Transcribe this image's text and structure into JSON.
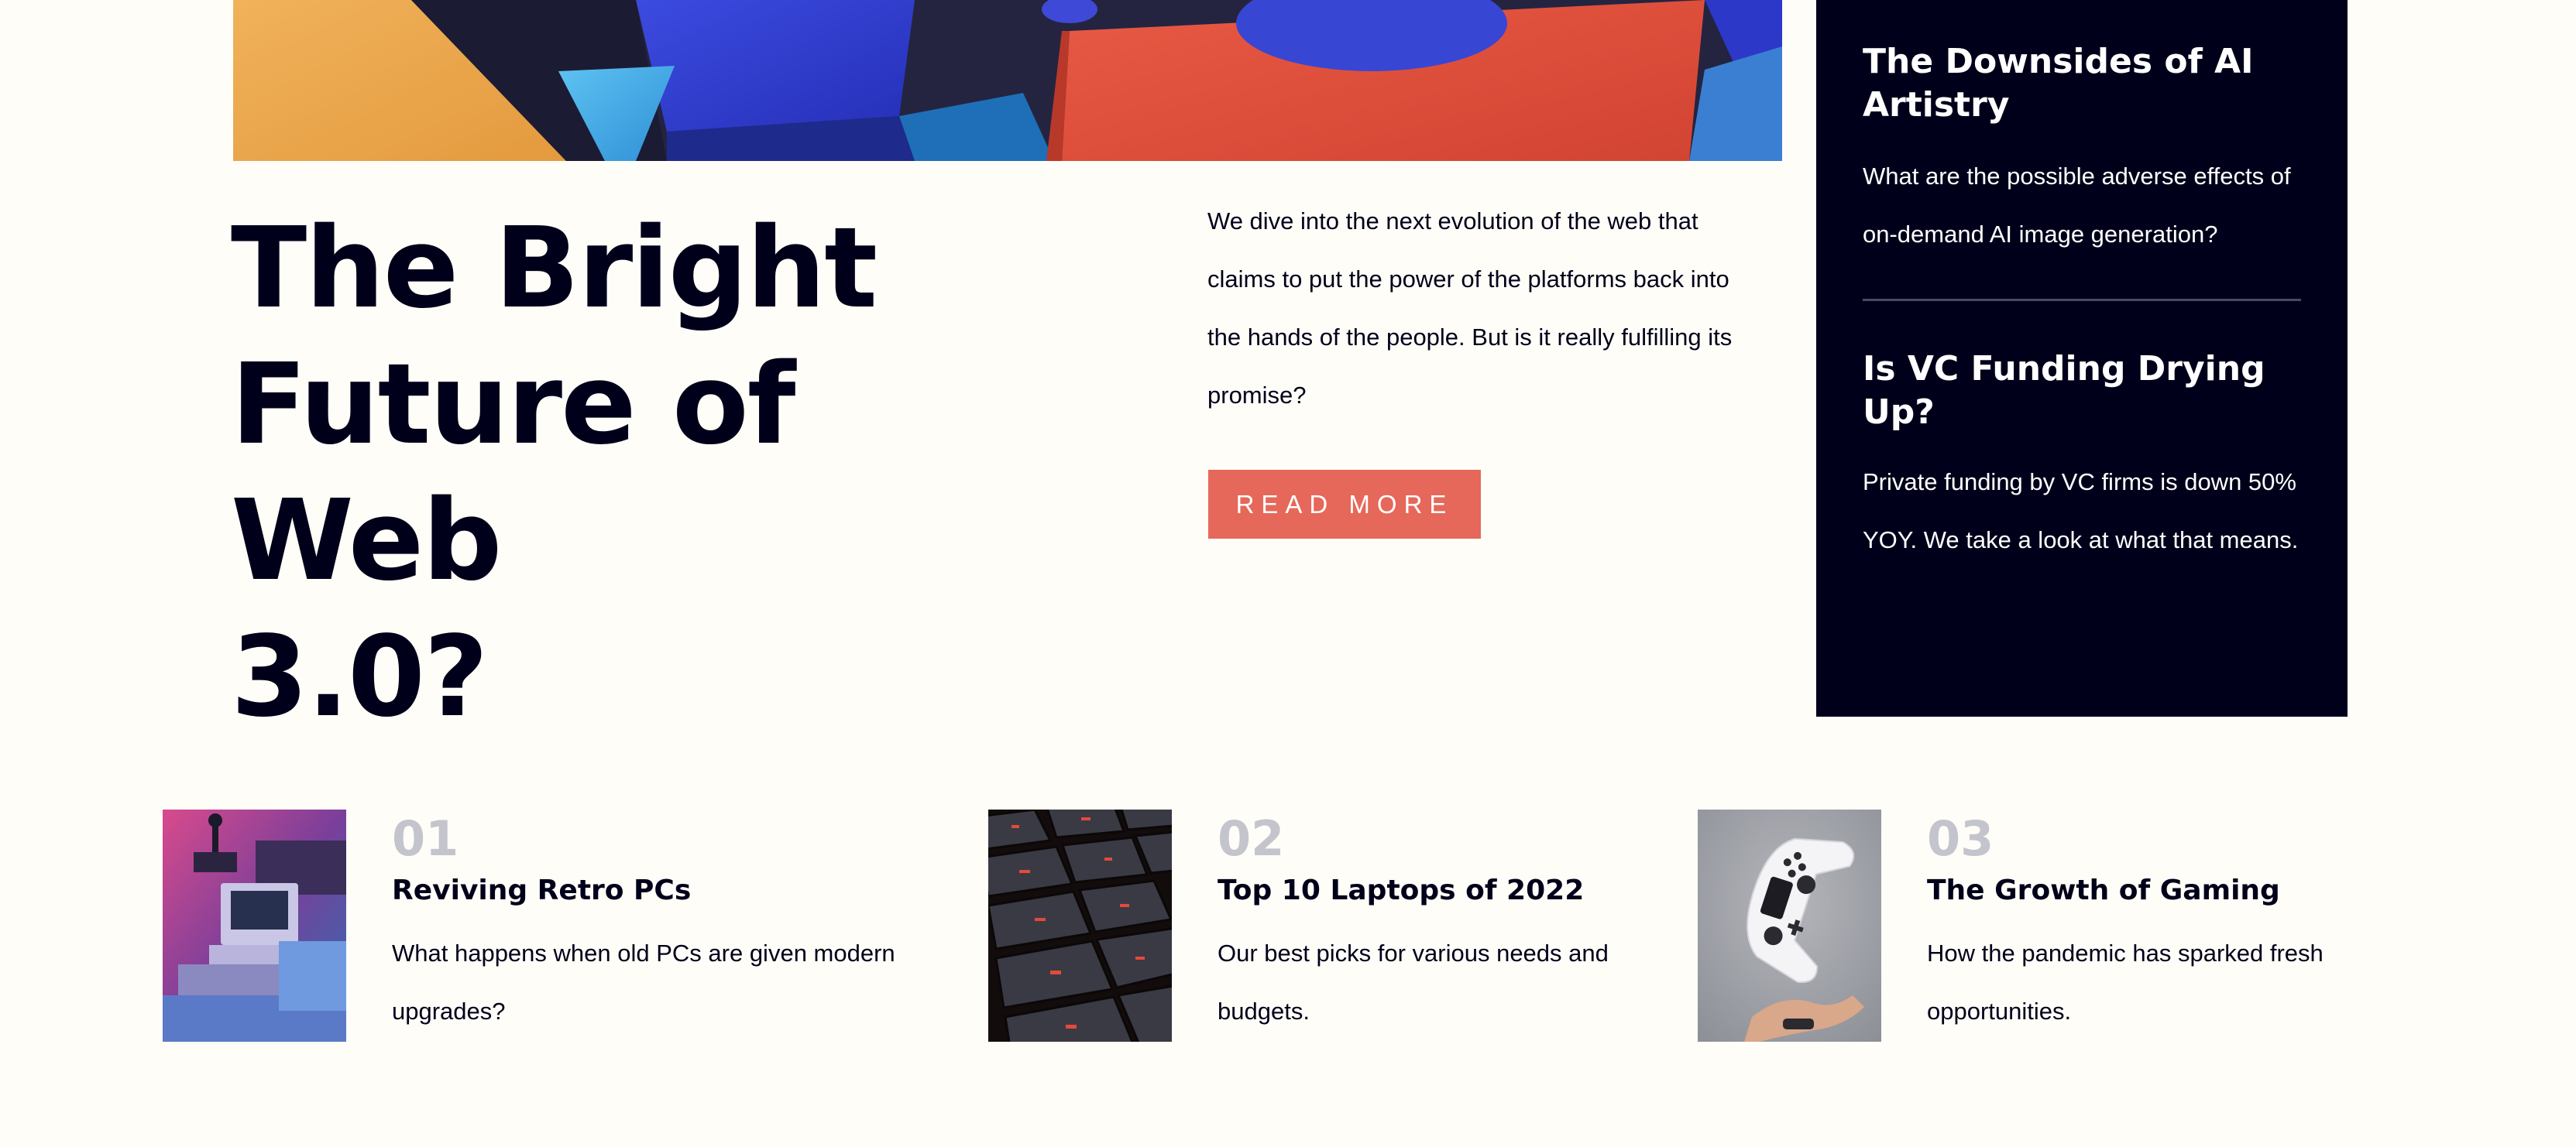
{
  "hero": {
    "title_lines": [
      "The Bright",
      "Future of Web",
      "3.0?"
    ],
    "description": "We dive into the next evolution of the web that claims to put the power of the platforms back into the hands of the people. But is it really fulfilling its promise?",
    "button_label": "READ MORE"
  },
  "sidebar": {
    "items": [
      {
        "title": "The Downsides of AI Artistry",
        "text": "What are the possible adverse effects of on-demand AI image generation?"
      },
      {
        "title": "Is VC Funding Drying Up?",
        "text": "Private funding by VC firms is down 50% YOY. We take a look at what that means."
      }
    ]
  },
  "articles": [
    {
      "number": "01",
      "title": "Reviving Retro PCs",
      "text": "What happens when old PCs are given modern upgrades?",
      "image": "retro-pc-image"
    },
    {
      "number": "02",
      "title": "Top 10 Laptops of 2022",
      "text": "Our best picks for various needs and budgets.",
      "image": "laptop-keyboard-image"
    },
    {
      "number": "03",
      "title": "The Growth of Gaming",
      "text": "How the pandemic has sparked fresh opportunities.",
      "image": "gamepad-image"
    }
  ],
  "colors": {
    "background": "#fffdf8",
    "navy": "#00001a",
    "accent": "#e5685a",
    "muted_number": "#c3c4cc"
  }
}
